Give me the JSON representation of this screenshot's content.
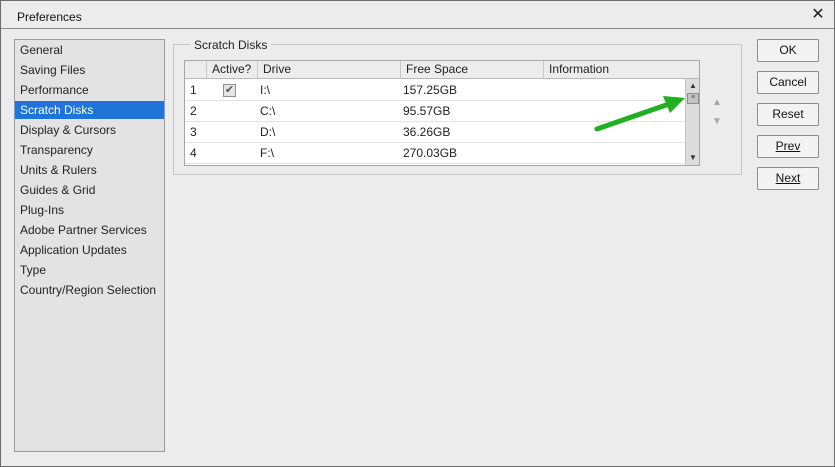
{
  "window": {
    "title": "Preferences",
    "close_glyph": "✕"
  },
  "sidebar": {
    "items": [
      {
        "label": "General",
        "active": false
      },
      {
        "label": "Saving Files",
        "active": false
      },
      {
        "label": "Performance",
        "active": false
      },
      {
        "label": "Scratch Disks",
        "active": true
      },
      {
        "label": "Display & Cursors",
        "active": false
      },
      {
        "label": "Transparency",
        "active": false
      },
      {
        "label": "Units & Rulers",
        "active": false
      },
      {
        "label": "Guides & Grid",
        "active": false
      },
      {
        "label": "Plug-Ins",
        "active": false
      },
      {
        "label": "Adobe Partner Services",
        "active": false
      },
      {
        "label": "Application Updates",
        "active": false
      },
      {
        "label": "Type",
        "active": false
      },
      {
        "label": "Country/Region Selection",
        "active": false
      }
    ]
  },
  "scratch_disks": {
    "group_label": "Scratch Disks",
    "columns": [
      "Active?",
      "Drive",
      "Free Space",
      "Information"
    ],
    "rows": [
      {
        "index": "1",
        "active": true,
        "drive": "I:\\",
        "free_space": "157.25GB",
        "information": ""
      },
      {
        "index": "2",
        "active": false,
        "drive": "C:\\",
        "free_space": "95.57GB",
        "information": ""
      },
      {
        "index": "3",
        "active": false,
        "drive": "D:\\",
        "free_space": "36.26GB",
        "information": ""
      },
      {
        "index": "4",
        "active": false,
        "drive": "F:\\",
        "free_space": "270.03GB",
        "information": ""
      }
    ],
    "scroll_up_glyph": "▲",
    "scroll_down_glyph": "▼",
    "thumb_glyph": "≡",
    "move_up_glyph": "▲",
    "move_down_glyph": "▼"
  },
  "annotation": {
    "arrow_color": "#22b022"
  },
  "buttons": {
    "ok": "OK",
    "cancel": "Cancel",
    "reset": "Reset",
    "prev": "Prev",
    "next": "Next"
  },
  "colors": {
    "selection": "#1e74d8"
  }
}
